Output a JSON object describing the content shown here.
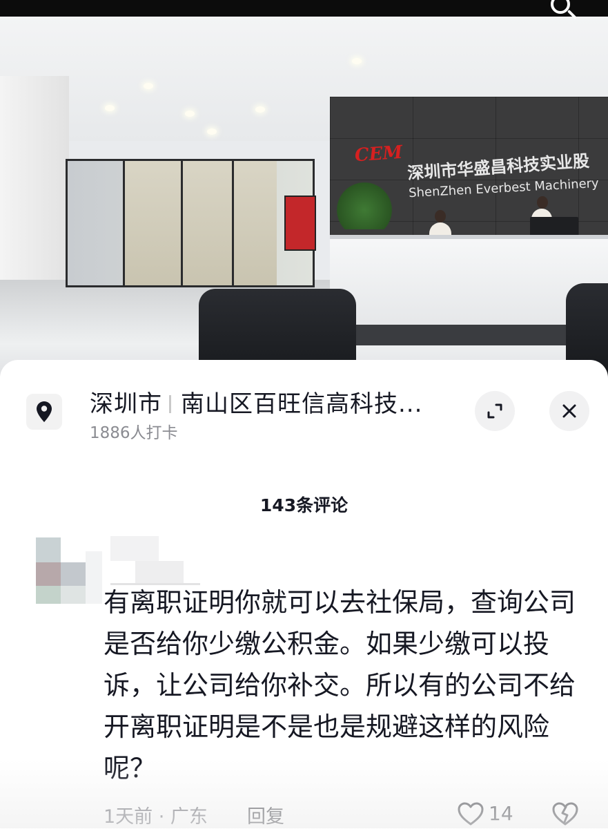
{
  "photo": {
    "sign_logo": "CEM",
    "sign_chinese": "深圳市华盛昌科技实业股",
    "sign_english": "ShenZhen Everbest Machinery"
  },
  "location": {
    "icon": "location-pin-icon",
    "city": "深圳市",
    "address": "南山区百旺信高科技...",
    "checkins": "1886人打卡",
    "expand_icon": "expand-icon",
    "close_icon": "close-icon"
  },
  "comments": {
    "title": "143条评论",
    "items": [
      {
        "lines": [
          "有离职证明你就可以去社保局，查询公司",
          "是否给你少缴公积金。如果少缴可以投",
          "诉，让公司给你补交。所以有的公司不给",
          "开离职证明是不是也是规避这样的风险",
          "呢？"
        ],
        "meta": "1天前 · 广东",
        "reply_label": "回复",
        "likes": "14"
      }
    ]
  },
  "colors": {
    "text_primary": "#161823",
    "text_secondary": "#8a8b91",
    "sign_red": "#d62020"
  }
}
